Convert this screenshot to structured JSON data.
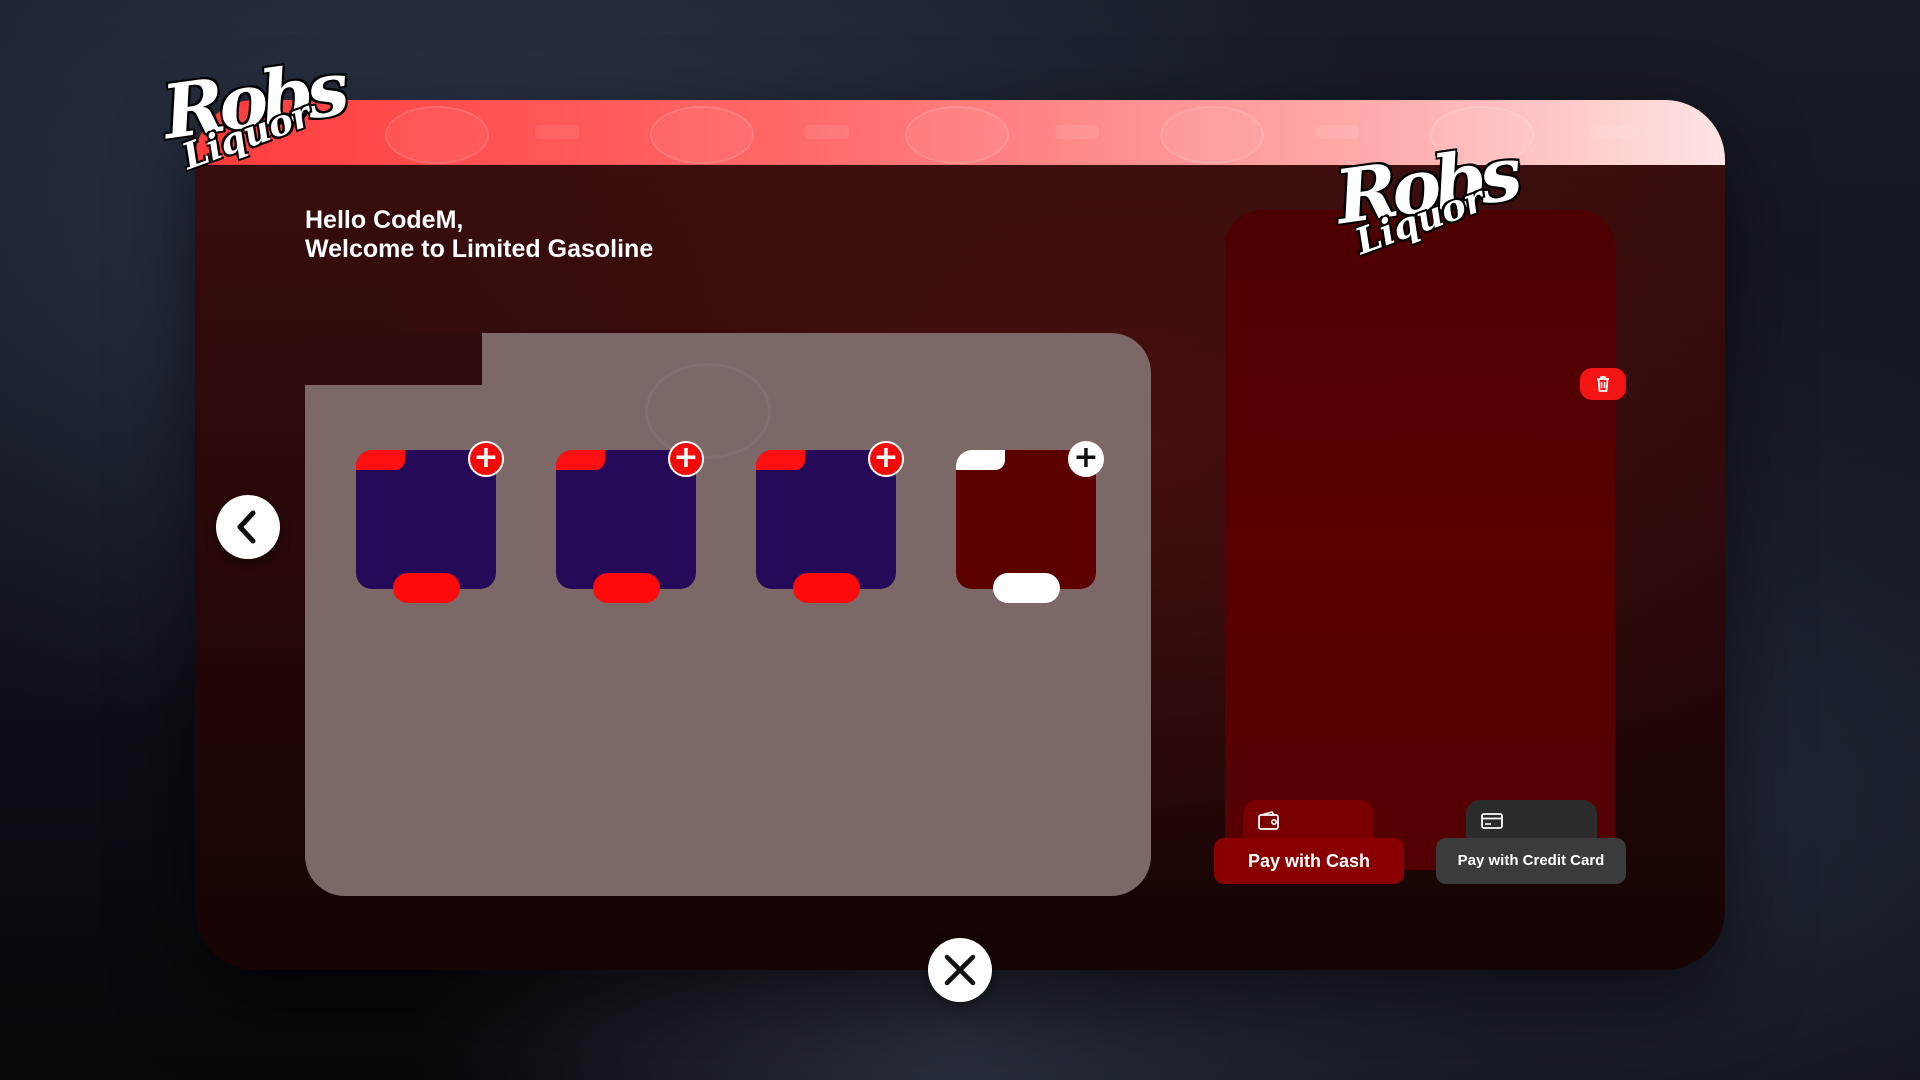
{
  "brand": {
    "logo_line1": "Robs",
    "logo_line2": "Liquor"
  },
  "greeting": {
    "line1": "Hello CodeM,",
    "line2": "Welcome to Limited Gasoline"
  },
  "products": [
    {
      "theme": "purple",
      "accent_color": "#ff1010",
      "card_color": "#240a58",
      "add_icon": "plus-icon"
    },
    {
      "theme": "purple",
      "accent_color": "#ff1010",
      "card_color": "#240a58",
      "add_icon": "plus-icon"
    },
    {
      "theme": "purple",
      "accent_color": "#ff1010",
      "card_color": "#240a58",
      "add_icon": "plus-icon"
    },
    {
      "theme": "dark-red",
      "accent_color": "#ffffff",
      "card_color": "#5c0000",
      "add_icon": "plus-icon"
    }
  ],
  "navigation": {
    "back_icon": "chevron-left-icon",
    "close_icon": "close-icon"
  },
  "cart": {
    "clear_icon": "trash-icon"
  },
  "payment": {
    "cash_label": "Pay with Cash",
    "cash_icon": "wallet-icon",
    "card_label": "Pay with Credit Card",
    "card_icon": "credit-card-icon"
  },
  "colors": {
    "accent": "#ff1010",
    "panel": "#2a0808",
    "cart_panel": "#590000",
    "products_bg": "#7d6868"
  }
}
